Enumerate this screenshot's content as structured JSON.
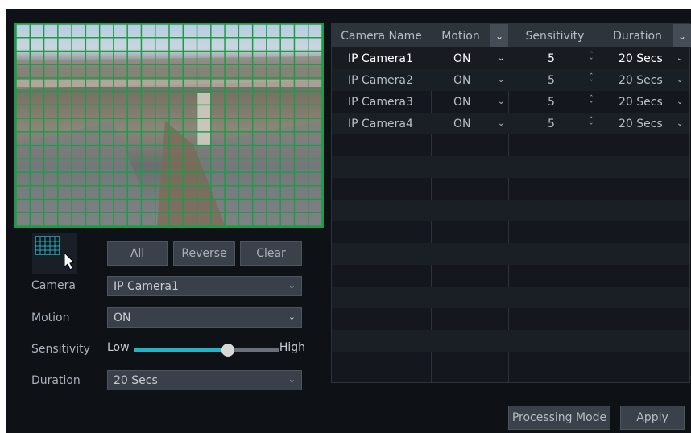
{
  "region_buttons": {
    "all": "All",
    "reverse": "Reverse",
    "clear": "Clear"
  },
  "form": {
    "camera_label": "Camera",
    "camera_value": "IP Camera1",
    "motion_label": "Motion",
    "motion_value": "ON",
    "sensitivity_label": "Sensitivity",
    "sensitivity_low": "Low",
    "sensitivity_high": "High",
    "sensitivity_level": 0.65,
    "duration_label": "Duration",
    "duration_value": "20 Secs"
  },
  "table": {
    "headers": {
      "camera_name": "Camera Name",
      "motion": "Motion",
      "sensitivity": "Sensitivity",
      "duration": "Duration"
    },
    "rows": [
      {
        "camera": "IP Camera1",
        "motion": "ON",
        "sensitivity": "5",
        "duration": "20 Secs"
      },
      {
        "camera": "IP Camera2",
        "motion": "ON",
        "sensitivity": "5",
        "duration": "20 Secs"
      },
      {
        "camera": "IP Camera3",
        "motion": "ON",
        "sensitivity": "5",
        "duration": "20 Secs"
      },
      {
        "camera": "IP Camera4",
        "motion": "ON",
        "sensitivity": "5",
        "duration": "20 Secs"
      }
    ]
  },
  "footer": {
    "processing_mode": "Processing Mode",
    "apply": "Apply"
  },
  "colors": {
    "grid": "#1f9a4a",
    "accent": "#22b3c4",
    "background": "#0e1116"
  }
}
